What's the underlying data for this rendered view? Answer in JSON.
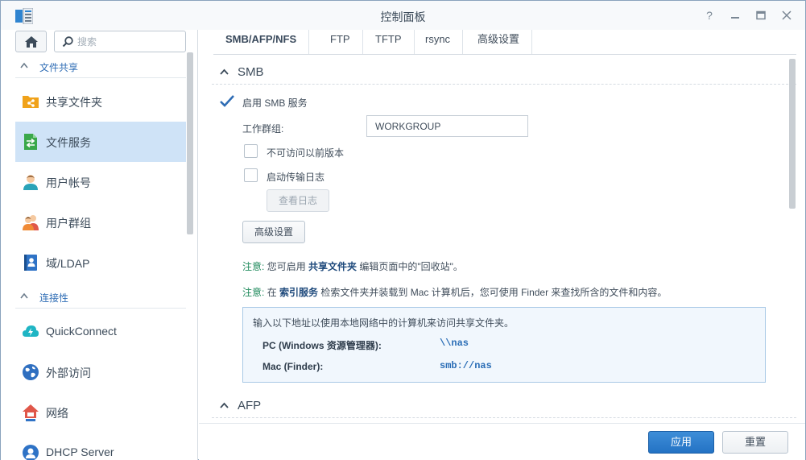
{
  "window": {
    "title": "控制面板",
    "controls": [
      "help-icon",
      "minimize-icon",
      "maximize-icon",
      "close-icon"
    ]
  },
  "sidebar": {
    "search_placeholder": "搜索",
    "sections": [
      {
        "label": "文件共享",
        "items": [
          {
            "label": "共享文件夹",
            "icon": "shared-folder-icon"
          },
          {
            "label": "文件服务",
            "icon": "file-services-icon",
            "active": true
          },
          {
            "label": "用户帐号",
            "icon": "user-icon"
          },
          {
            "label": "用户群组",
            "icon": "group-icon"
          },
          {
            "label": "域/LDAP",
            "icon": "domain-ldap-icon"
          }
        ]
      },
      {
        "label": "连接性",
        "items": [
          {
            "label": "QuickConnect",
            "icon": "quickconnect-icon"
          },
          {
            "label": "外部访问",
            "icon": "external-access-icon"
          },
          {
            "label": "网络",
            "icon": "network-icon"
          },
          {
            "label": "DHCP Server",
            "icon": "dhcp-server-icon"
          }
        ]
      }
    ]
  },
  "tabs": [
    {
      "label": "SMB/AFP/NFS",
      "active": true
    },
    {
      "label": "FTP"
    },
    {
      "label": "TFTP"
    },
    {
      "label": "rsync"
    },
    {
      "label": "高级设置"
    }
  ],
  "smb": {
    "header": "SMB",
    "enable_label": "启用 SMB 服务",
    "enable_checked": true,
    "workgroup_label": "工作群组:",
    "workgroup_value": "WORKGROUP",
    "hide_previous_label": "不可访问以前版本",
    "hide_previous_checked": false,
    "transfer_log_label": "启动传输日志",
    "transfer_log_checked": false,
    "view_log_button": "查看日志",
    "advanced_button": "高级设置",
    "note1": {
      "label": "注意:",
      "pre": "您可启用",
      "link": "共享文件夹",
      "post": "编辑页面中的\"回收站\"。"
    },
    "note2": {
      "label": "注意:",
      "pre": "在",
      "link": "索引服务",
      "post": "检索文件夹并装载到 Mac 计算机后，您可使用 Finder 来查找所含的文件和内容。"
    },
    "info": {
      "intro": "输入以下地址以使用本地网络中的计算机来访问共享文件夹。",
      "pc_label": "PC (Windows 资源管理器):",
      "pc_value": "\\\\nas",
      "mac_label": "Mac (Finder):",
      "mac_value": "smb://nas"
    }
  },
  "afp": {
    "header": "AFP"
  },
  "footer": {
    "apply": "应用",
    "reset": "重置"
  },
  "colors": {
    "accent": "#2372c4",
    "active_nav": "#cfe3f7",
    "note_green": "#1f8a5c",
    "link_blue": "#2a6db6"
  }
}
